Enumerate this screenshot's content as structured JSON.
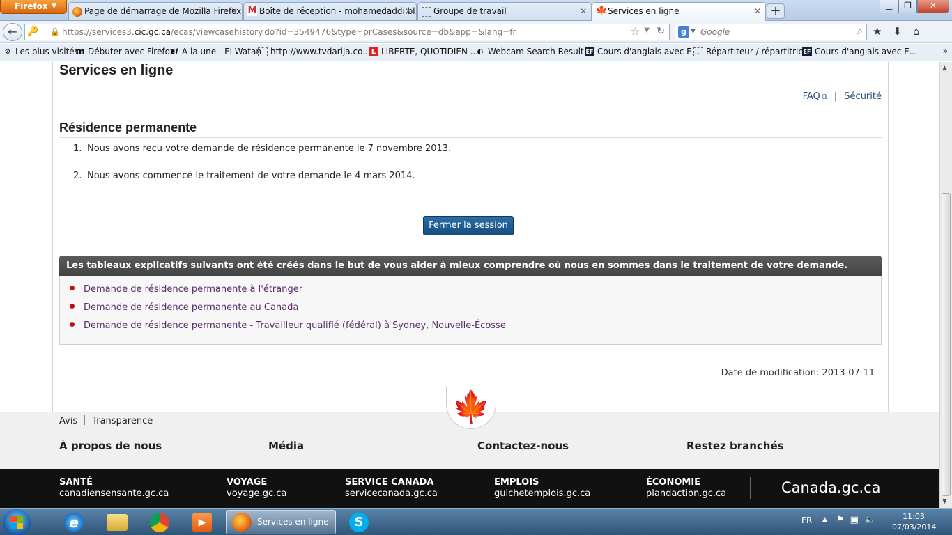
{
  "browser": {
    "app_button": "Firefox",
    "tabs": [
      {
        "label": "Page de démarrage de Mozilla Firefox",
        "icon": "firefox-icon"
      },
      {
        "label": "Boîte de réception - mohamedaddi.bl...",
        "icon": "gmail-icon"
      },
      {
        "label": "Groupe de travail",
        "icon": "blank-page-icon"
      },
      {
        "label": "Services en ligne",
        "icon": "maple-leaf-icon",
        "active": true
      }
    ],
    "url_prefix": "https://services3.",
    "url_domain": "cic.gc.ca",
    "url_path": "/ecas/viewcasehistory.do?id=3549476&type=prCases&source=db&app=&lang=fr",
    "search_placeholder": "Google",
    "search_engine": "g",
    "bookmarks": [
      {
        "label": "Les plus visités",
        "icon": "gear-icon"
      },
      {
        "label": "Débuter avec Firefox",
        "icon": "m-icon"
      },
      {
        "label": "A la une - El Watan",
        "icon": "elwatan-icon"
      },
      {
        "label": "http://www.tvdarija.co...",
        "icon": "blank-page-icon"
      },
      {
        "label": "LIBERTE, QUOTIDIEN ...",
        "icon": "liberte-icon"
      },
      {
        "label": "Webcam Search Result...",
        "icon": "webcam-icon"
      },
      {
        "label": "Cours d'anglais avec E...",
        "icon": "ef-icon"
      },
      {
        "label": "Répartiteur / répartitric...",
        "icon": "blank-page-icon"
      },
      {
        "label": "Cours d'anglais avec E...",
        "icon": "ef-icon"
      }
    ],
    "bookmarks_more": "»"
  },
  "page": {
    "title": "Services en ligne",
    "faq_link": "FAQ",
    "separator": "|",
    "security_link": "Sécurité",
    "section_title": "Résidence permanente",
    "status_items": [
      {
        "num": "1.",
        "text": "Nous avons reçu votre demande de résidence permanente le 7 novembre 2013."
      },
      {
        "num": "2.",
        "text": "Nous avons commencé le traitement de votre demande le 4 mars 2014."
      }
    ],
    "logout_button": "Fermer la session",
    "panel_header": "Les tableaux explicatifs suivants ont été créés dans le but de vous aider à mieux comprendre où nous en sommes dans le traitement de votre demande.",
    "panel_links": [
      "Demande de résidence permanente à l'étranger",
      "Demande de résidence permanente au Canada",
      "Demande de résidence permanente - Travailleur qualifié (fédéral) à Sydney, Nouvelle-Écosse"
    ],
    "date_modified": "Date de modification: 2013-07-11"
  },
  "footer": {
    "small_links": [
      "Avis",
      "Transparence"
    ],
    "columns": [
      "À propos de nous",
      "Média",
      "Contactez-nous",
      "Restez branchés"
    ],
    "theme_links": [
      {
        "title": "SANTÉ",
        "site": "canadiensensante.gc.ca"
      },
      {
        "title": "VOYAGE",
        "site": "voyage.gc.ca"
      },
      {
        "title": "SERVICE CANADA",
        "site": "servicecanada.gc.ca"
      },
      {
        "title": "EMPLOIS",
        "site": "guichetemplois.gc.ca"
      },
      {
        "title": "ÉCONOMIE",
        "site": "plandaction.gc.ca"
      }
    ],
    "brand": "Canada.gc.ca"
  },
  "taskbar": {
    "active_task": "Services en ligne - ...",
    "language": "FR",
    "time": "11:03",
    "date": "07/03/2014"
  },
  "colors": {
    "header_bar": "#4a4a4a",
    "button_blue": "#1d5a8e",
    "link_visited": "#5a2a6a",
    "bullet_red": "#bb1111",
    "maple_red": "#d52b1e"
  }
}
